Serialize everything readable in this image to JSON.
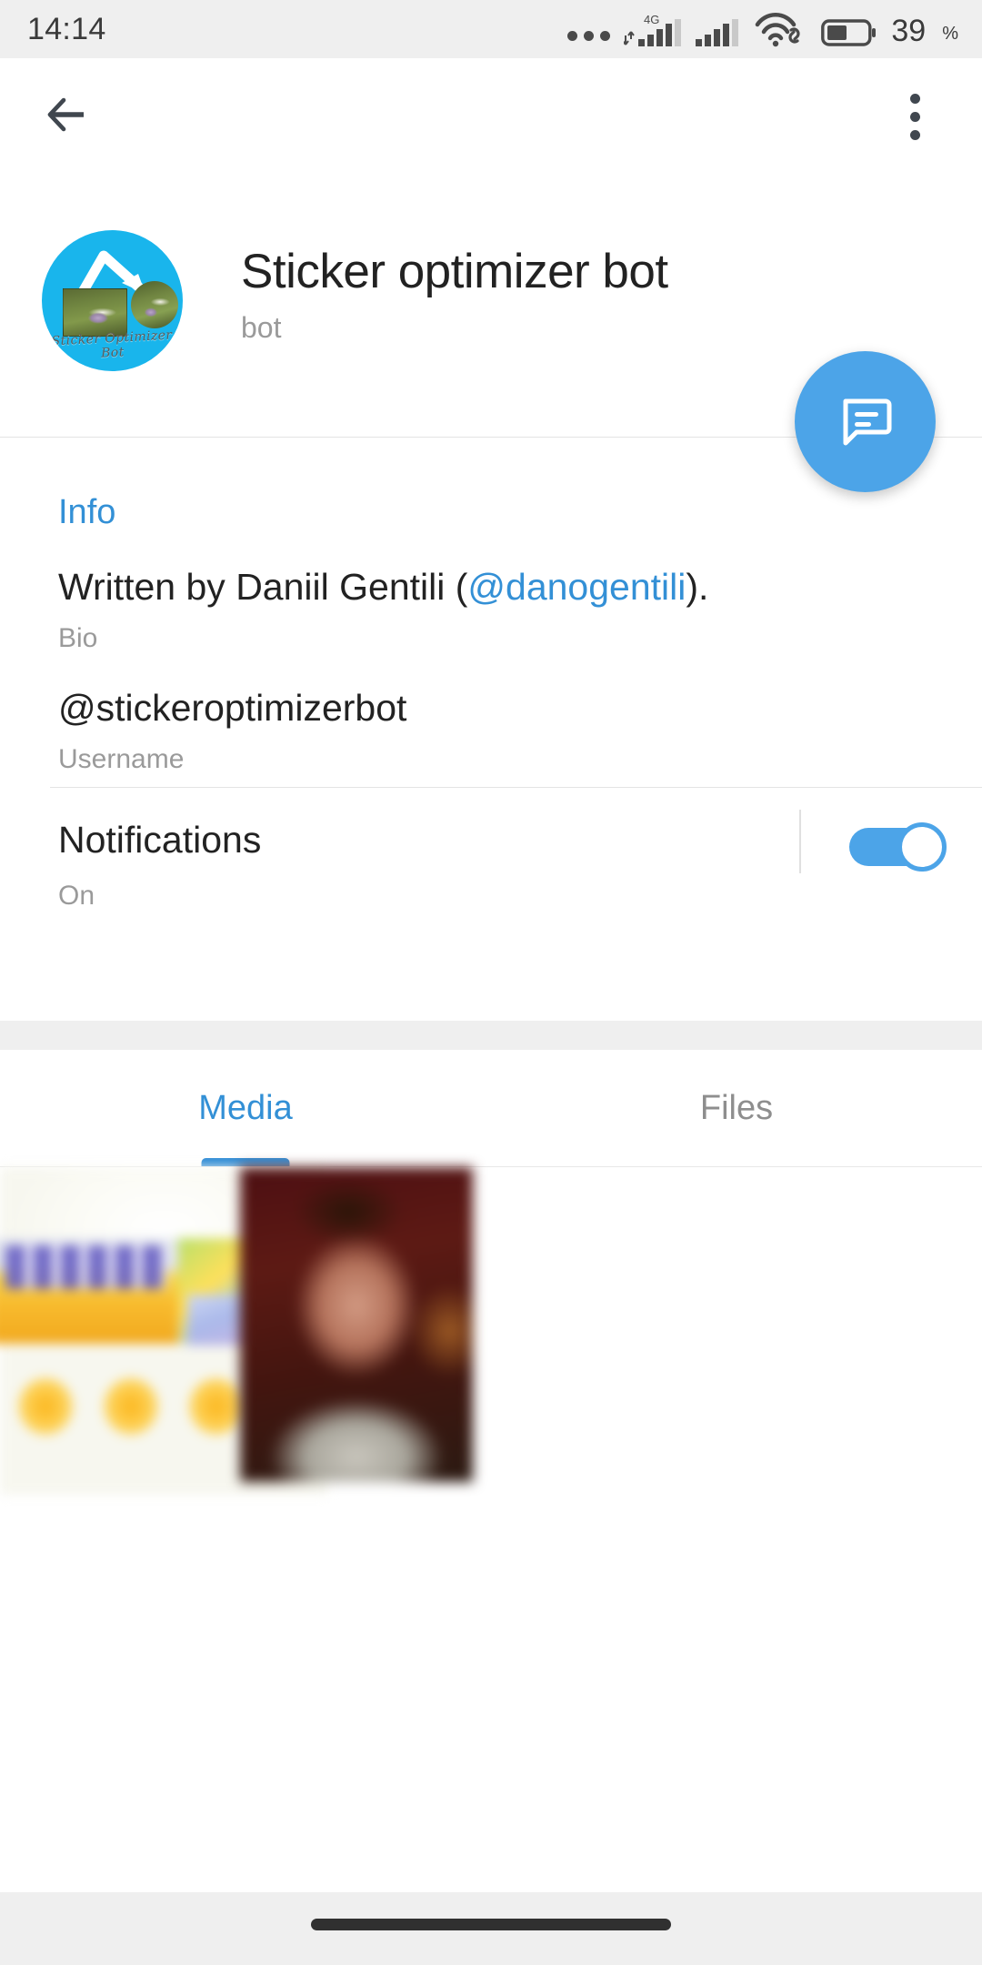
{
  "statusbar": {
    "time": "14:14",
    "battery_percent": "39",
    "battery_unit": "%",
    "icons": [
      "more-dots-icon",
      "cellular-4g-icon",
      "cellular-signal-icon",
      "wifi-link-icon",
      "battery-icon"
    ],
    "network_label": "4G",
    "background": "#efefef"
  },
  "appbar": {
    "back_icon": "back-arrow-icon",
    "menu_icon": "overflow-menu-icon"
  },
  "profile": {
    "title": "Sticker optimizer bot",
    "subtitle": "bot",
    "avatar": {
      "icon": "sticker-optimizer-bot-avatar",
      "caption": "Sticker Optimizer Bot",
      "background": "#19B5EC"
    }
  },
  "fab": {
    "icon": "message-bubble-icon",
    "color": "#4CA4E8",
    "label": "Send message"
  },
  "info": {
    "header": "Info",
    "rows": [
      {
        "value_prefix": "Written by Daniil Gentili (",
        "value_link": "@danogentili",
        "value_suffix": ").",
        "label": "Bio"
      },
      {
        "value": "@stickeroptimizerbot",
        "label": "Username"
      }
    ],
    "notifications": {
      "value": "Notifications",
      "label": "On",
      "toggle_state": "on",
      "toggle_color": "#4CA4E8"
    },
    "accent_color": "#3390d6"
  },
  "tabs": {
    "items": [
      {
        "label": "Media",
        "active": true
      },
      {
        "label": "Files",
        "active": false
      }
    ],
    "active_color": "#3390d6",
    "inactive_color": "#8e8e8e",
    "indicator_color": "#2f8cd6"
  },
  "media": {
    "thumbnails": [
      {
        "name": "media-thumbnail-1",
        "alt": "blurred product package photo"
      },
      {
        "name": "media-thumbnail-2",
        "alt": "blurred portrait photo"
      }
    ]
  },
  "navbar": {
    "gesture_bar": "home-gesture-bar"
  }
}
